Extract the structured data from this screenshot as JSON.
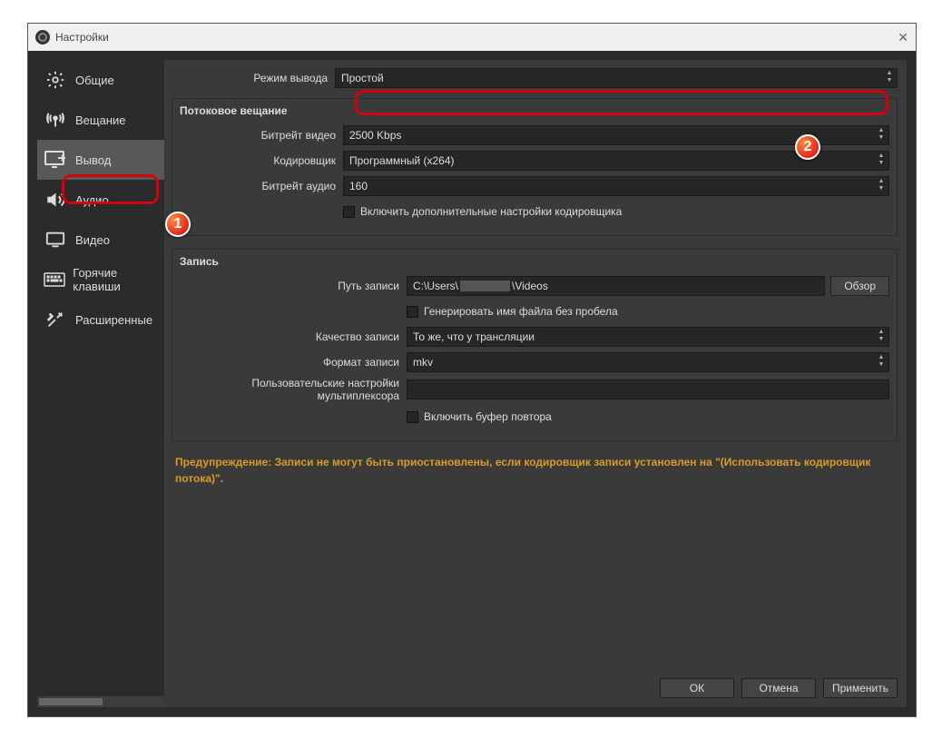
{
  "window": {
    "title": "Настройки"
  },
  "sidebar": {
    "items": [
      {
        "label": "Общие"
      },
      {
        "label": "Вещание"
      },
      {
        "label": "Вывод"
      },
      {
        "label": "Аудио"
      },
      {
        "label": "Видео"
      },
      {
        "label": "Горячие клавиши"
      },
      {
        "label": "Расширенные"
      }
    ]
  },
  "output": {
    "mode_label": "Режим вывода",
    "mode_value": "Простой"
  },
  "streaming": {
    "title": "Потоковое вещание",
    "video_bitrate_label": "Битрейт видео",
    "video_bitrate_value": "2500 Kbps",
    "encoder_label": "Кодировщик",
    "encoder_value": "Программный (x264)",
    "audio_bitrate_label": "Битрейт аудио",
    "audio_bitrate_value": "160",
    "advanced_checkbox": "Включить дополнительные настройки кодировщика"
  },
  "recording": {
    "title": "Запись",
    "path_label": "Путь записи",
    "path_prefix": "C:\\Users\\",
    "path_suffix": "\\Videos",
    "browse": "Обзор",
    "nospace_checkbox": "Генерировать имя файла без пробела",
    "quality_label": "Качество записи",
    "quality_value": "То же, что у трансляции",
    "format_label": "Формат записи",
    "format_value": "mkv",
    "mux_label": "Пользовательские настройки мультиплексора",
    "replay_checkbox": "Включить буфер повтора"
  },
  "warning": "Предупреждение: Записи не могут быть приостановлены, если кодировщик записи установлен на \"(Использовать кодировщик потока)\".",
  "footer": {
    "ok": "ОК",
    "cancel": "Отмена",
    "apply": "Применить"
  },
  "annotations": {
    "b1": "1",
    "b2": "2"
  }
}
